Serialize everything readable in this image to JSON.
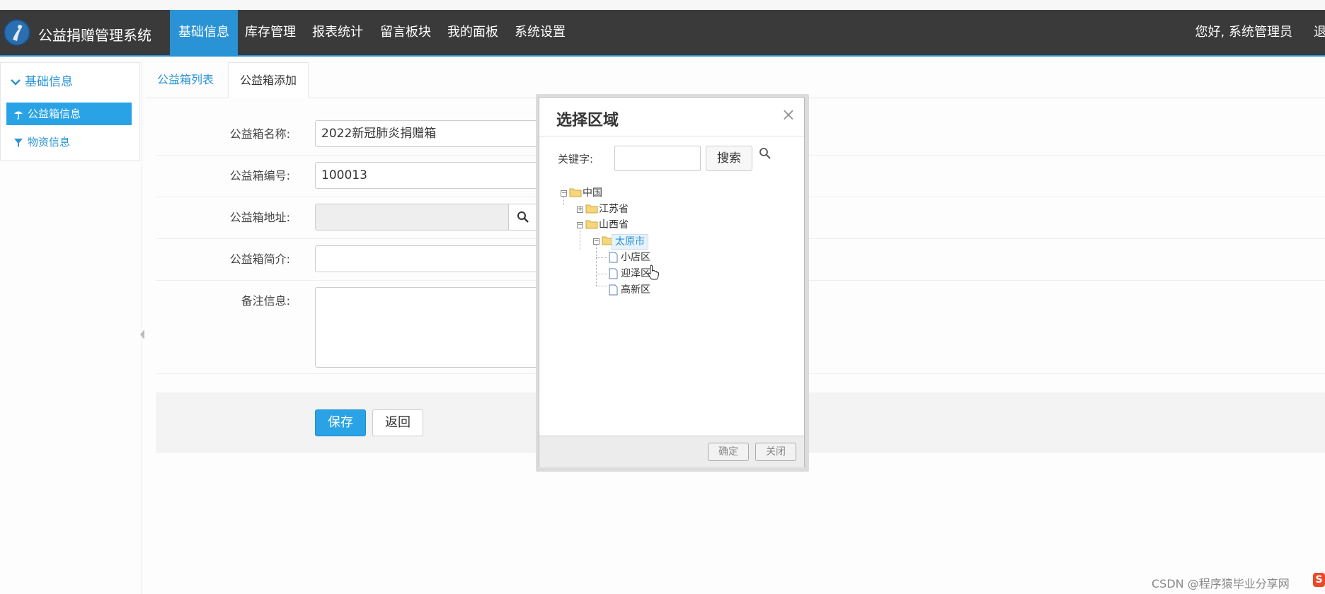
{
  "app": {
    "brand": "公益捐赠管理系统",
    "greeting": "您好, 系统管理员",
    "logout": "退出"
  },
  "nav": {
    "items": [
      "基础信息",
      "库存管理",
      "报表统计",
      "留言板块",
      "我的面板",
      "系统设置"
    ],
    "active_index": 0
  },
  "sidebar": {
    "header": "基础信息",
    "items": [
      "公益箱信息",
      "物资信息"
    ],
    "active_index": 0
  },
  "tabs": [
    "公益箱列表",
    "公益箱添加"
  ],
  "form": {
    "name_label": "公益箱名称:",
    "name_value": "2022新冠肺炎捐赠箱",
    "code_label": "公益箱编号:",
    "code_value": "100013",
    "address_label": "公益箱地址:",
    "intro_label": "公益箱简介:",
    "remark_label": "备注信息:",
    "save": "保存",
    "back": "返回"
  },
  "dialog": {
    "title": "选择区域",
    "keyword_label": "关键字:",
    "search_button": "搜索",
    "tree": {
      "root": "中国",
      "provinces": [
        "江苏省",
        "山西省"
      ],
      "city": "太原市",
      "districts": [
        "小店区",
        "迎泽区",
        "高新区"
      ]
    },
    "confirm": "确定",
    "close": "关闭"
  },
  "watermark": "CSDN @程序猿毕业分享网",
  "colors": {
    "accent": "#2a93d5",
    "navbar": "#3a3a3a",
    "active_sidebar": "#2aa3e6"
  }
}
